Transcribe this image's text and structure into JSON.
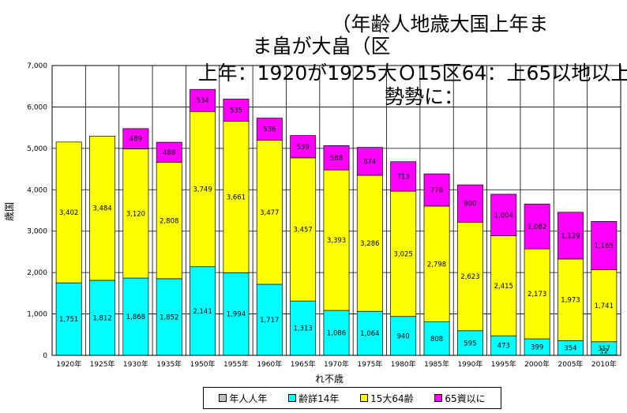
{
  "title_lines": [
    "（年齢人地歳大国上年ま",
    "ま畠が大畠（区",
    "上年：1920が1925大Ｏ15区64：上65以地以上。",
    "勢勢に："
  ],
  "colors": {
    "age_0_14": "#00ffff",
    "age_15_64": "#ffff00",
    "age_65_plus": "#ff00ff",
    "unknown": "#c0c0c0",
    "grid": "#000000"
  },
  "chart_data": {
    "type": "bar",
    "stacked": true,
    "title": "（年齢人地歳大国上年ま ま畠が大畠（区 上年：1920が1925大Ｏ15区64：上65以地以上。 勢勢に：",
    "xlabel": "れ不歳",
    "ylabel": "歳国",
    "ylim": [
      0,
      7000
    ],
    "yticks": [
      "0",
      "1,000",
      "2,000",
      "3,000",
      "4,000",
      "5,000",
      "6,000",
      "7,000"
    ],
    "grid": true,
    "legend_position": "bottom",
    "categories": [
      "1920年",
      "1925年",
      "1930年",
      "1935年",
      "1950年",
      "1955年",
      "1960年",
      "1965年",
      "1970年",
      "1975年",
      "1980年",
      "1985年",
      "1990年",
      "1995年",
      "2000年",
      "2005年",
      "2010年"
    ],
    "series": [
      {
        "name": "年人人年",
        "key": "unknown",
        "values": [
          0,
          0,
          0,
          0,
          0,
          0,
          0,
          0,
          0,
          0,
          0,
          0,
          0,
          0,
          0,
          0,
          12
        ],
        "labels": [
          "",
          "",
          "",
          "",
          "",
          "",
          "",
          "",
          "",
          "",
          "",
          "",
          "",
          "",
          "",
          "",
          "12"
        ]
      },
      {
        "name": "齢詳14年",
        "key": "age_0_14",
        "values": [
          1751,
          1812,
          1868,
          1852,
          2141,
          1994,
          1717,
          1313,
          1086,
          1064,
          940,
          808,
          595,
          473,
          399,
          354,
          317
        ],
        "labels": [
          "1,751",
          "1,812",
          "1,868",
          "1,852",
          "2,141",
          "1,994",
          "1,717",
          "1,313",
          "1,086",
          "1,064",
          "940",
          "808",
          "595",
          "473",
          "399",
          "354",
          "317"
        ]
      },
      {
        "name": "15大64齢",
        "key": "age_15_64",
        "values": [
          3402,
          3484,
          3120,
          2808,
          3749,
          3661,
          3477,
          3457,
          3393,
          3286,
          3025,
          2798,
          2623,
          2415,
          2173,
          1973,
          1741
        ],
        "labels": [
          "3,402",
          "3,484",
          "3,120",
          "2,808",
          "3,749",
          "3,661",
          "3,477",
          "3,457",
          "3,393",
          "3,286",
          "3,025",
          "2,798",
          "2,623",
          "2,415",
          "2,173",
          "1,973",
          "1,741"
        ]
      },
      {
        "name": "65資以に",
        "key": "age_65_plus",
        "values": [
          0,
          0,
          489,
          488,
          534,
          535,
          536,
          539,
          588,
          674,
          713,
          778,
          900,
          1004,
          1082,
          1129,
          1165
        ],
        "labels": [
          "",
          "",
          "489",
          "488",
          "534",
          "535",
          "536",
          "539",
          "588",
          "674",
          "713",
          "778",
          "900",
          "1,004",
          "1,082",
          "1,129",
          "1,165"
        ]
      }
    ],
    "legend": [
      "年人人年",
      "齢詳14年",
      "15大64齢",
      "65資以に"
    ]
  }
}
